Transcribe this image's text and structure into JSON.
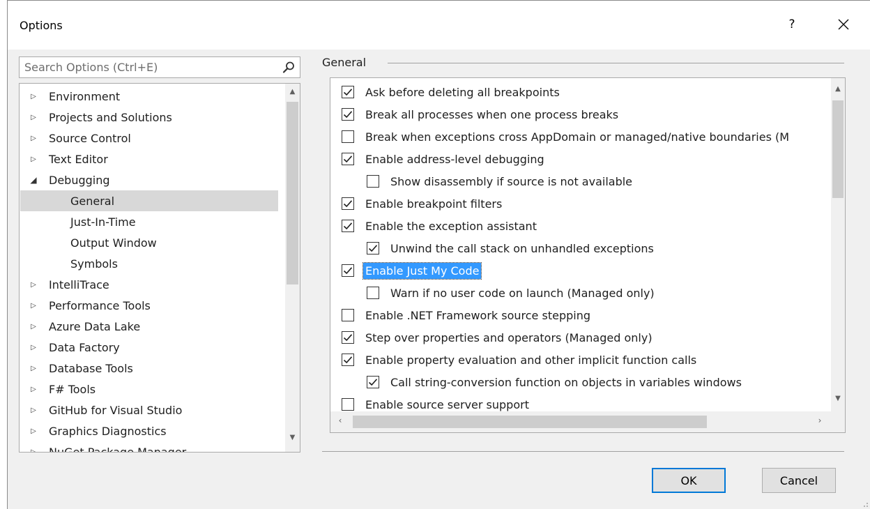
{
  "window": {
    "title": "Options",
    "help_label": "?"
  },
  "search": {
    "placeholder": "Search Options (Ctrl+E)"
  },
  "tree": [
    {
      "label": "Environment",
      "type": "collapsed"
    },
    {
      "label": "Projects and Solutions",
      "type": "collapsed"
    },
    {
      "label": "Source Control",
      "type": "collapsed"
    },
    {
      "label": "Text Editor",
      "type": "collapsed"
    },
    {
      "label": "Debugging",
      "type": "expanded"
    },
    {
      "label": "General",
      "type": "child",
      "selected": true
    },
    {
      "label": "Just-In-Time",
      "type": "child"
    },
    {
      "label": "Output Window",
      "type": "child"
    },
    {
      "label": "Symbols",
      "type": "child"
    },
    {
      "label": "IntelliTrace",
      "type": "collapsed"
    },
    {
      "label": "Performance Tools",
      "type": "collapsed"
    },
    {
      "label": "Azure Data Lake",
      "type": "collapsed"
    },
    {
      "label": "Data Factory",
      "type": "collapsed"
    },
    {
      "label": "Database Tools",
      "type": "collapsed"
    },
    {
      "label": "F# Tools",
      "type": "collapsed"
    },
    {
      "label": "GitHub for Visual Studio",
      "type": "collapsed"
    },
    {
      "label": "Graphics Diagnostics",
      "type": "collapsed"
    },
    {
      "label": "NuGet Package Manager",
      "type": "collapsed"
    }
  ],
  "section": {
    "header": "General"
  },
  "options": [
    {
      "label": "Ask before deleting all breakpoints",
      "checked": true,
      "indent": 0
    },
    {
      "label": "Break all processes when one process breaks",
      "checked": true,
      "indent": 0
    },
    {
      "label": "Break when exceptions cross AppDomain or managed/native boundaries (M",
      "checked": false,
      "indent": 0
    },
    {
      "label": "Enable address-level debugging",
      "checked": true,
      "indent": 0
    },
    {
      "label": "Show disassembly if source is not available",
      "checked": false,
      "indent": 1
    },
    {
      "label": "Enable breakpoint filters",
      "checked": true,
      "indent": 0
    },
    {
      "label": "Enable the exception assistant",
      "checked": true,
      "indent": 0
    },
    {
      "label": "Unwind the call stack on unhandled exceptions",
      "checked": true,
      "indent": 1
    },
    {
      "label": "Enable Just My Code",
      "checked": true,
      "indent": 0,
      "highlighted": true
    },
    {
      "label": "Warn if no user code on launch (Managed only)",
      "checked": false,
      "indent": 1
    },
    {
      "label": "Enable .NET Framework source stepping",
      "checked": false,
      "indent": 0
    },
    {
      "label": "Step over properties and operators (Managed only)",
      "checked": true,
      "indent": 0
    },
    {
      "label": "Enable property evaluation and other implicit function calls",
      "checked": true,
      "indent": 0
    },
    {
      "label": "Call string-conversion function on objects in variables windows",
      "checked": true,
      "indent": 1
    },
    {
      "label": "Enable source server support",
      "checked": false,
      "indent": 0
    }
  ],
  "buttons": {
    "ok": "OK",
    "cancel": "Cancel"
  },
  "colors": {
    "selection": "#3399ff",
    "tree_selected": "#d8d8d8",
    "primary_border": "#0078d7"
  }
}
